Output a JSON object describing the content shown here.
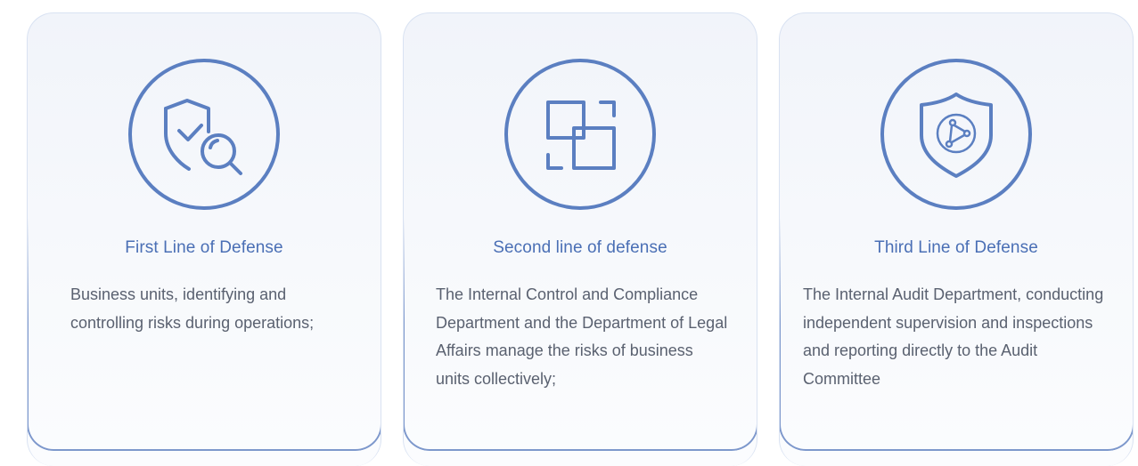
{
  "colors": {
    "accent": "#5b7fc1",
    "title": "#4a6fb5",
    "text": "#5a6170",
    "card_bg": "#f4f6fb"
  },
  "cards": [
    {
      "icon": "shield-search-icon",
      "title": "First Line of Defense",
      "description": "Business units, identifying and controlling risks during operations;"
    },
    {
      "icon": "overlapping-squares-icon",
      "title": "Second line of defense",
      "description": "The Internal Control and Compliance Department and the Department of Legal Affairs manage the risks of business units collectively;"
    },
    {
      "icon": "shield-network-icon",
      "title": "Third Line of Defense",
      "description": "The Internal Audit Department, conducting independent supervision and inspections and reporting directly to the Audit Committee"
    }
  ]
}
